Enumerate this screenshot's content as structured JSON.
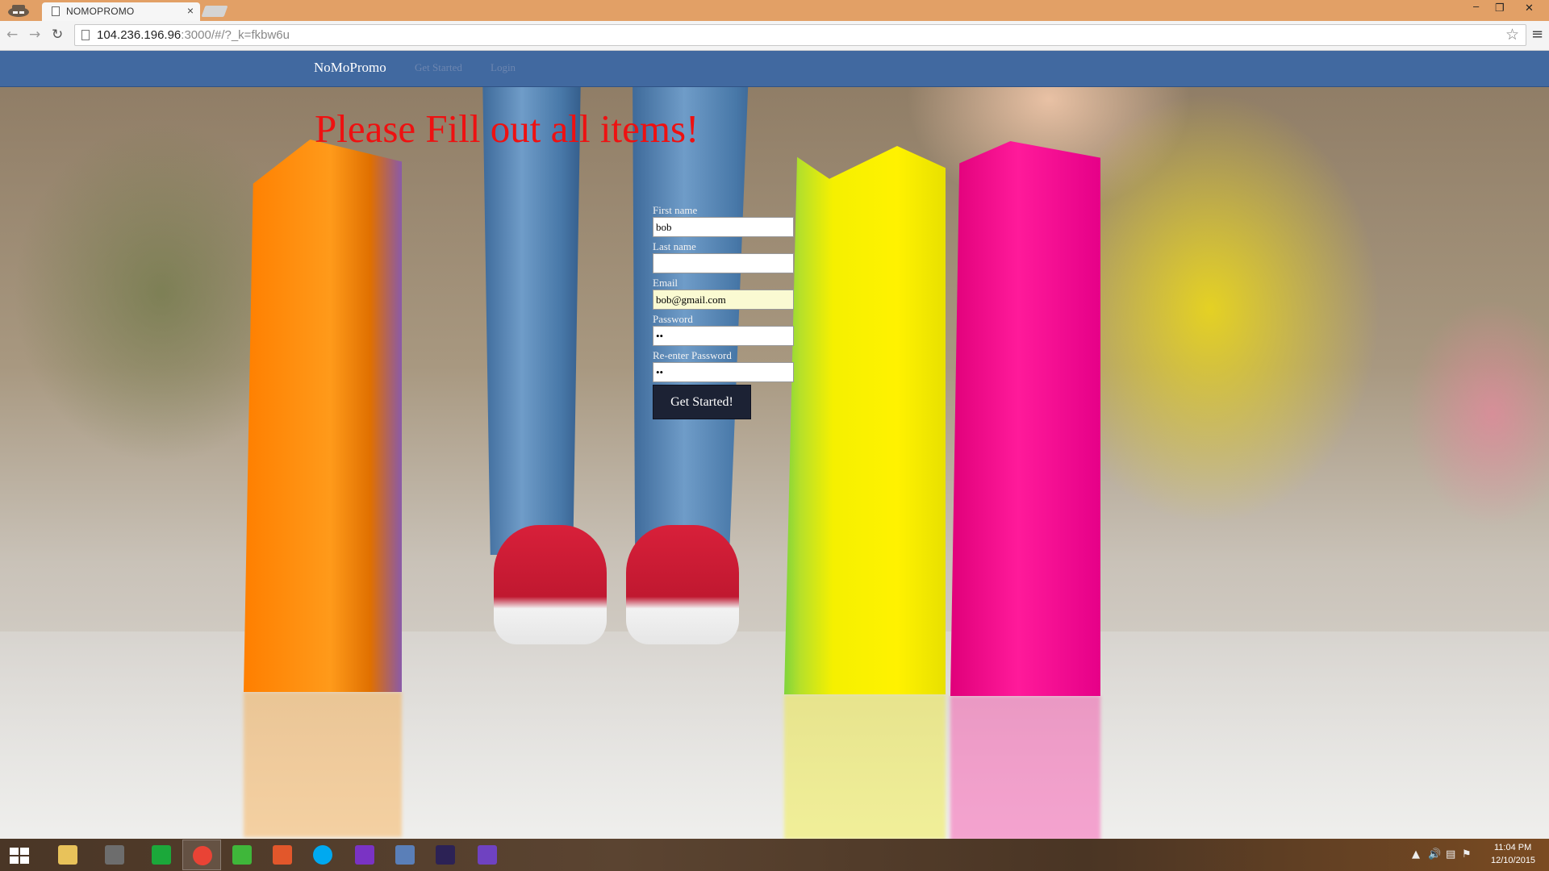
{
  "browser": {
    "tab_title": "NOMOPROMO",
    "tab_close": "×",
    "url_host": "104.236.196.96",
    "url_rest": ":3000/#/?_k=fkbw6u",
    "back_glyph": "←",
    "forward_glyph": "→",
    "reload_glyph": "↻",
    "star_glyph": "☆",
    "menu_glyph": "≡",
    "min_glyph": "‒",
    "restore_glyph": "❐",
    "close_glyph": "✕"
  },
  "navbar": {
    "brand": "NoMoPromo",
    "links": [
      "Get Started",
      "Login"
    ],
    "bg_color": "#4169a0"
  },
  "page": {
    "error_message": "Please Fill out all items!",
    "error_color": "#ee1111"
  },
  "form": {
    "fields": [
      {
        "label": "First name",
        "value": "bob",
        "type": "text"
      },
      {
        "label": "Last name",
        "value": "",
        "type": "text"
      },
      {
        "label": "Email",
        "value": "bob@gmail.com",
        "type": "email"
      },
      {
        "label": "Password",
        "value": "••",
        "type": "password"
      },
      {
        "label": "Re-enter Password",
        "value": "••",
        "type": "password"
      }
    ],
    "submit_label": "Get Started!"
  },
  "taskbar": {
    "apps": [
      {
        "name": "file-explorer-icon",
        "color": "#e8c25a"
      },
      {
        "name": "app-icon-2",
        "color": "#6d6d6d"
      },
      {
        "name": "store-icon",
        "color": "#1ba83a"
      },
      {
        "name": "chrome-icon",
        "color": "#e94335"
      },
      {
        "name": "wechat-icon",
        "color": "#3fb73a"
      },
      {
        "name": "image-viewer-icon",
        "color": "#e2572b"
      },
      {
        "name": "skype-icon",
        "color": "#00a9f0"
      },
      {
        "name": "search-app-icon",
        "color": "#7a33c4"
      },
      {
        "name": "remote-desktop-icon",
        "color": "#5a7fb8"
      },
      {
        "name": "eclipse-icon",
        "color": "#2c2255"
      },
      {
        "name": "github-icon",
        "color": "#6f42c1"
      }
    ],
    "tray_glyphs": [
      "▲",
      "🔊",
      "▤",
      "⚑"
    ],
    "time": "11:04 PM",
    "date": "12/10/2015"
  }
}
